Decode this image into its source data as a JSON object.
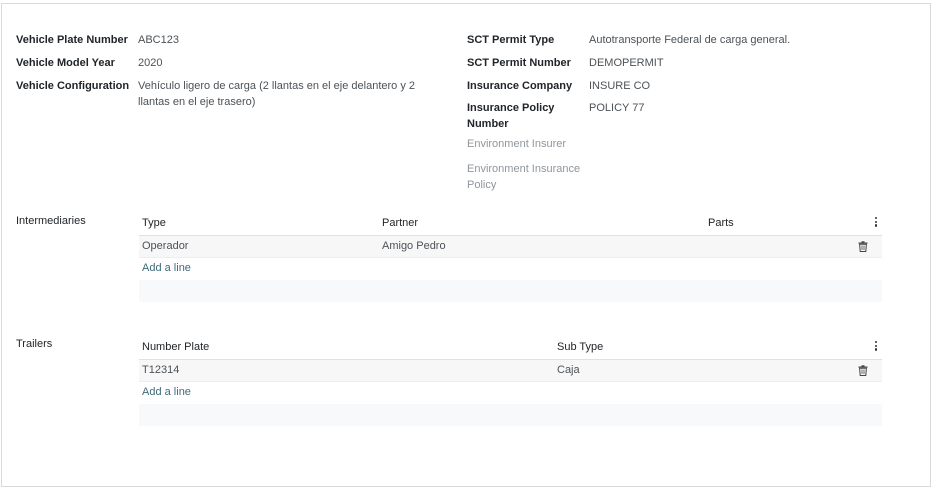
{
  "left_fields": [
    {
      "label": "Vehicle Plate Number",
      "value": "ABC123"
    },
    {
      "label": "Vehicle Model Year",
      "value": "2020"
    },
    {
      "label": "Vehicle Configuration",
      "value_line1": "Vehículo ligero de carga (2 llantas en el eje delantero y 2",
      "value_line2": "llantas en el eje trasero)"
    }
  ],
  "right_fields": [
    {
      "label": "SCT Permit Type",
      "value": "Autotransporte Federal de carga general."
    },
    {
      "label": "SCT Permit Number",
      "value": "DEMOPERMIT"
    },
    {
      "label": "Insurance Company",
      "value": "INSURE CO"
    },
    {
      "label_line1": "Insurance Policy",
      "label_line2": "Number",
      "value": "POLICY 77"
    },
    {
      "label": "Environment Insurer",
      "value": ""
    },
    {
      "label_line1": "Environment Insurance",
      "label_line2": "Policy",
      "value": ""
    }
  ],
  "intermediaries": {
    "label": "Intermediaries",
    "columns": [
      "Type",
      "Partner",
      "Parts"
    ],
    "rows": [
      {
        "type": "Operador",
        "partner": "Amigo Pedro",
        "parts": ""
      }
    ],
    "add_line": "Add a line"
  },
  "trailers": {
    "label": "Trailers",
    "columns": [
      "Number Plate",
      "Sub Type"
    ],
    "rows": [
      {
        "number_plate": "T12314",
        "sub_type": "Caja"
      }
    ],
    "add_line": "Add a line"
  },
  "colors": {
    "link": "#3f6a79",
    "muted_label": "#8f969c",
    "row_bg": "#f7f7f8"
  }
}
